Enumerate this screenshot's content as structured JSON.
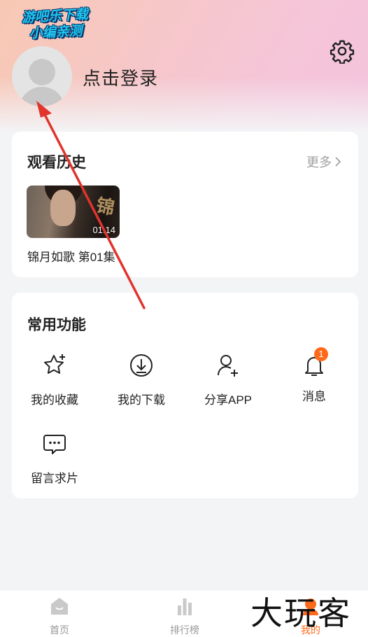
{
  "watermark": {
    "line1": "游吧乐下载",
    "line2": "小编亲测"
  },
  "header": {
    "login_text": "点击登录"
  },
  "history": {
    "title": "观看历史",
    "more_label": "更多",
    "item": {
      "title": "锦月如歌 第01集",
      "duration": "01:14",
      "poster_glyph": "锦"
    }
  },
  "functions": {
    "title": "常用功能",
    "items": [
      {
        "label": "我的收藏",
        "icon": "star-icon"
      },
      {
        "label": "我的下载",
        "icon": "download-icon"
      },
      {
        "label": "分享APP",
        "icon": "share-user-icon"
      },
      {
        "label": "消息",
        "icon": "bell-icon",
        "badge": "1"
      },
      {
        "label": "留言求片",
        "icon": "message-icon"
      }
    ]
  },
  "tabbar": {
    "items": [
      {
        "label": "首页",
        "icon": "home-icon"
      },
      {
        "label": "排行榜",
        "icon": "chart-icon"
      },
      {
        "label": "我的",
        "icon": "me-icon",
        "active": true
      }
    ]
  },
  "brand_watermark": "大玩客",
  "colors": {
    "accent": "#ff6a1a",
    "annotation_arrow": "#e0342d"
  }
}
